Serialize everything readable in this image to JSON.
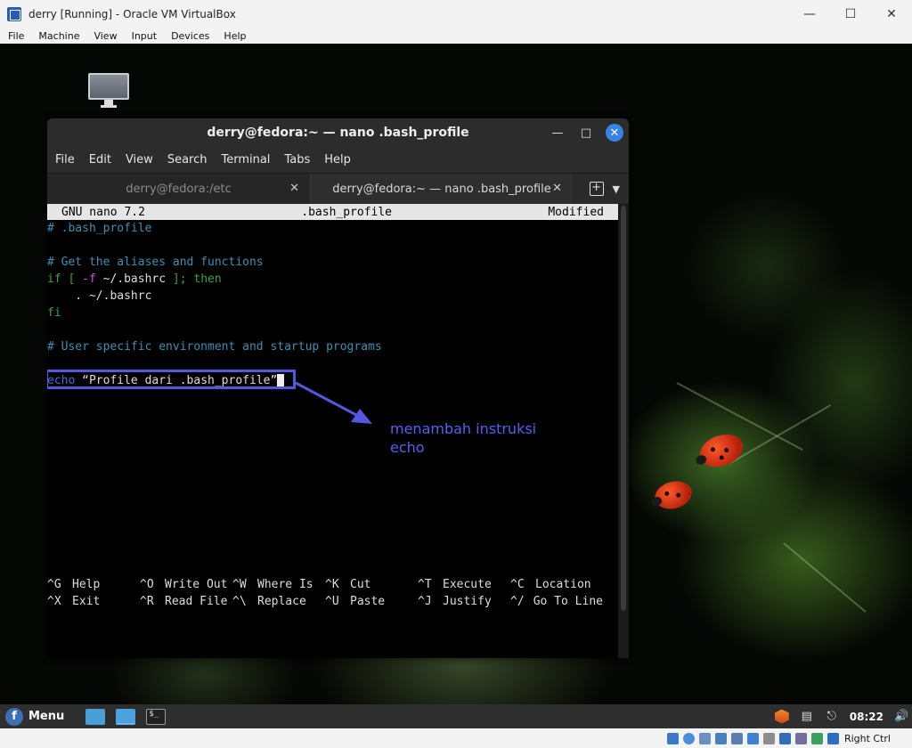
{
  "host": {
    "title": "derry [Running] - Oracle VM VirtualBox",
    "menu": [
      "File",
      "Machine",
      "View",
      "Input",
      "Devices",
      "Help"
    ],
    "host_key": "Right Ctrl"
  },
  "terminal": {
    "title": "derry@fedora:~ — nano .bash_profile",
    "menu": [
      "File",
      "Edit",
      "View",
      "Search",
      "Terminal",
      "Tabs",
      "Help"
    ],
    "tabs": [
      {
        "label": "derry@fedora:/etc",
        "active": false
      },
      {
        "label": "derry@fedora:~ — nano .bash_profile",
        "active": true
      }
    ]
  },
  "nano": {
    "version": "GNU nano 7.2",
    "filename": ".bash_profile",
    "status": "Modified",
    "lines": {
      "l1": "# .bash_profile",
      "l3": "# Get the aliases and functions",
      "l4_if": "if [ ",
      "l4_flag": "-f",
      "l4_path": " ~/.bashrc",
      "l4_rest": " ]; then",
      "l5": "    . ~/.bashrc",
      "l6": "fi",
      "l8": "# User specific environment and startup programs",
      "l10_echo": "echo",
      "l10_rest": " “Profile dari .bash_profile”"
    },
    "shortcuts": [
      [
        {
          "key": "^G",
          "label": "Help"
        },
        {
          "key": "^O",
          "label": "Write Out"
        },
        {
          "key": "^W",
          "label": "Where Is"
        },
        {
          "key": "^K",
          "label": "Cut"
        },
        {
          "key": "^T",
          "label": "Execute"
        },
        {
          "key": "^C",
          "label": "Location"
        }
      ],
      [
        {
          "key": "^X",
          "label": "Exit"
        },
        {
          "key": "^R",
          "label": "Read File"
        },
        {
          "key": "^\\",
          "label": "Replace"
        },
        {
          "key": "^U",
          "label": "Paste"
        },
        {
          "key": "^J",
          "label": "Justify"
        },
        {
          "key": "^/",
          "label": "Go To Line"
        }
      ]
    ]
  },
  "annotation": {
    "line1": "menambah instruksi",
    "line2": "echo",
    "color": "#5a5ef0"
  },
  "taskbar": {
    "menu_label": "Menu",
    "clock": "08:22"
  }
}
